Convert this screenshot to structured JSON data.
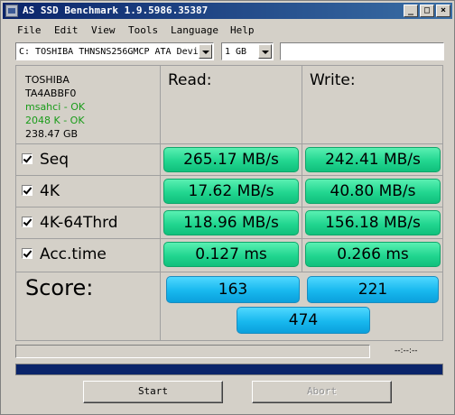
{
  "window": {
    "title": "AS SSD Benchmark 1.9.5986.35387",
    "controls": {
      "minimize": "_",
      "maximize": "□",
      "close": "×"
    }
  },
  "menu": {
    "items": [
      "File",
      "Edit",
      "View",
      "Tools",
      "Language",
      "Help"
    ]
  },
  "toolbar": {
    "drive_select": "C: TOSHIBA THNSNS256GMCP ATA Devi",
    "size_select": "1 GB",
    "text_field": ""
  },
  "drive_info": {
    "vendor": "TOSHIBA",
    "firmware": "TA4ABBF0",
    "driver_status": "msahci - OK",
    "alignment_status": "2048 K - OK",
    "capacity": "238.47 GB"
  },
  "columns": {
    "read": "Read:",
    "write": "Write:"
  },
  "tests": [
    {
      "label": "Seq",
      "checked": true,
      "read": "265.17 MB/s",
      "write": "242.41 MB/s"
    },
    {
      "label": "4K",
      "checked": true,
      "read": "17.62 MB/s",
      "write": "40.80 MB/s"
    },
    {
      "label": "4K-64Thrd",
      "checked": true,
      "read": "118.96 MB/s",
      "write": "156.18 MB/s"
    },
    {
      "label": "Acc.time",
      "checked": true,
      "read": "0.127 ms",
      "write": "0.266 ms"
    }
  ],
  "score": {
    "label": "Score:",
    "read": "163",
    "write": "221",
    "total": "474"
  },
  "status": {
    "elapsed": "--:--:--",
    "progress_fraction": 1.0
  },
  "buttons": {
    "start": "Start",
    "abort": "Abort"
  },
  "colors": {
    "title_bar": "#0a246a",
    "result_green": "#22d690",
    "score_blue": "#18b8ee",
    "progress": "#0a246a",
    "status_ok": "#1a9c1a"
  }
}
